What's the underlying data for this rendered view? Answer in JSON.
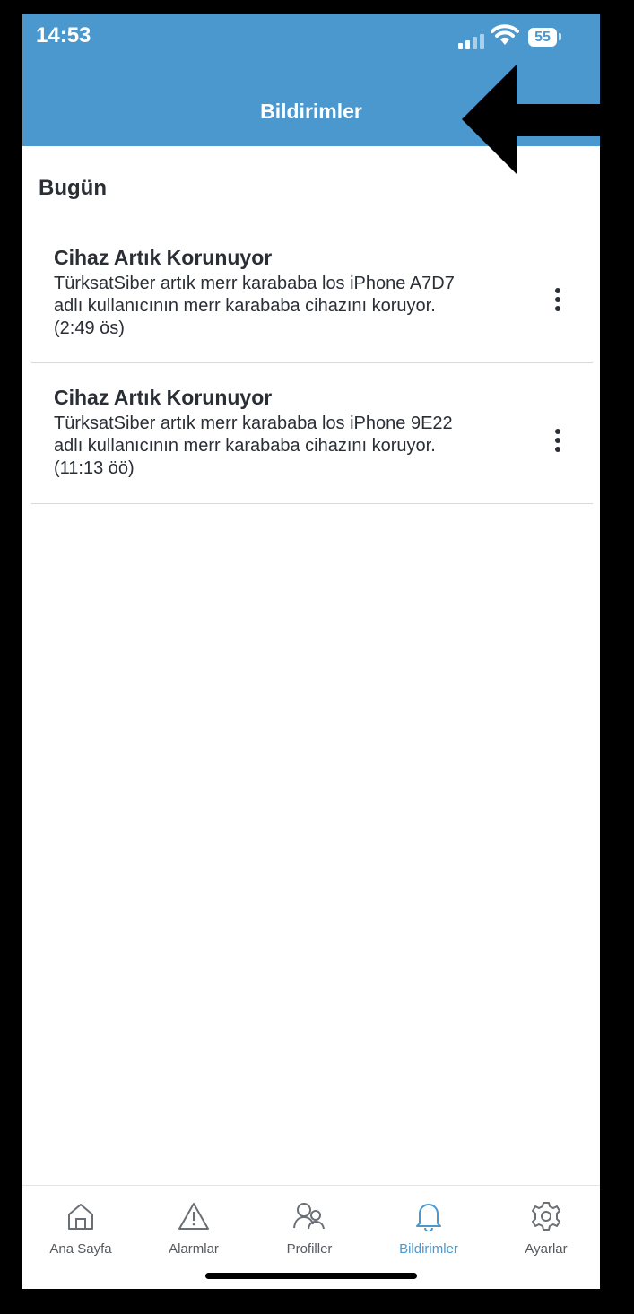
{
  "status_bar": {
    "time": "14:53",
    "battery": "55"
  },
  "header": {
    "title": "Bildirimler"
  },
  "section_title": "Bugün",
  "notifications": [
    {
      "title": "Cihaz Artık Korunuyor",
      "line1": "TürksatSiber artık merr karababa los iPhone A7D7",
      "line2": "adlı kullanıcının merr karababa cihazını koruyor.",
      "time": "(2:49 ös)"
    },
    {
      "title": "Cihaz Artık Korunuyor",
      "line1": "TürksatSiber artık merr karababa los iPhone 9E22",
      "line2": "adlı kullanıcının merr karababa cihazını koruyor.",
      "time": "(11:13 öö)"
    }
  ],
  "tabs": [
    {
      "label": "Ana Sayfa",
      "icon": "home-icon",
      "active": false
    },
    {
      "label": "Alarmlar",
      "icon": "warning-icon",
      "active": false
    },
    {
      "label": "Profiller",
      "icon": "profiles-icon",
      "active": false
    },
    {
      "label": "Bildirimler",
      "icon": "bell-icon",
      "active": true
    },
    {
      "label": "Ayarlar",
      "icon": "gear-icon",
      "active": false
    }
  ],
  "colors": {
    "header": "#4a98cd",
    "accent": "#4a98cd",
    "text": "#2a2e35"
  }
}
